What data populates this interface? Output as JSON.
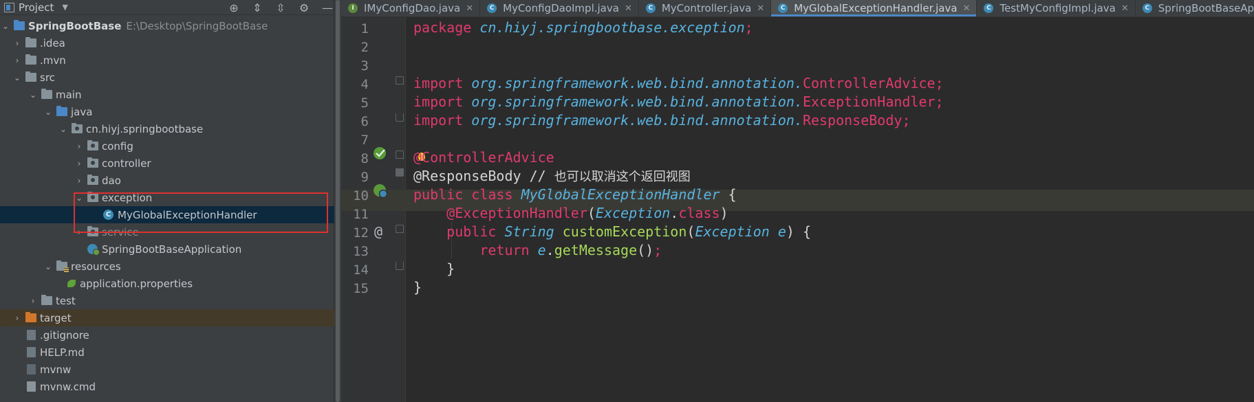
{
  "project_panel": {
    "title": "Project",
    "tree": [
      {
        "label": "SpringBootBase",
        "path": "E:\\Desktop\\SpringBootBase"
      },
      {
        "label": ".idea"
      },
      {
        "label": ".mvn"
      },
      {
        "label": "src"
      },
      {
        "label": "main"
      },
      {
        "label": "java"
      },
      {
        "label": "cn.hiyj.springbootbase"
      },
      {
        "label": "config"
      },
      {
        "label": "controller"
      },
      {
        "label": "dao"
      },
      {
        "label": "exception"
      },
      {
        "label": "MyGlobalExceptionHandler"
      },
      {
        "label": "service"
      },
      {
        "label": "SpringBootBaseApplication"
      },
      {
        "label": "resources"
      },
      {
        "label": "application.properties"
      },
      {
        "label": "test"
      },
      {
        "label": "target"
      },
      {
        "label": ".gitignore"
      },
      {
        "label": "HELP.md"
      },
      {
        "label": "mvnw"
      },
      {
        "label": "mvnw.cmd"
      }
    ]
  },
  "tabs": [
    {
      "label": "IMyConfigDao.java",
      "icon": "interface-icon"
    },
    {
      "label": "MyConfigDaoImpl.java",
      "icon": "class-icon"
    },
    {
      "label": "MyController.java",
      "icon": "class-icon"
    },
    {
      "label": "MyGlobalExceptionHandler.java",
      "icon": "class-icon",
      "active": true
    },
    {
      "label": "TestMyConfigImpl.java",
      "icon": "test-class-icon"
    },
    {
      "label": "SpringBootBaseApp",
      "icon": "spring-class-icon"
    }
  ],
  "editor": {
    "line_numbers": [
      "1",
      "2",
      "3",
      "4",
      "5",
      "6",
      "7",
      "8",
      "9",
      "10",
      "11",
      "12",
      "13",
      "14",
      "15"
    ],
    "lines": {
      "l1": {
        "kw": "package",
        "pkg": "cn.hiyj.springbootbase.exception",
        "semi": ";"
      },
      "l4": {
        "kw": "import",
        "pkg": "org.springframework.web.bind.annotation.",
        "cls": "ControllerAdvice",
        "semi": ";"
      },
      "l5": {
        "kw": "import",
        "pkg": "org.springframework.web.bind.annotation.",
        "cls": "ExceptionHandler",
        "semi": ";"
      },
      "l6": {
        "kw": "import",
        "pkg": "org.springframework.web.bind.annotation.",
        "cls": "ResponseBody",
        "semi": ";"
      },
      "l8": {
        "ann_first": "@",
        "ann_rest": "ControllerAdvice"
      },
      "l9": {
        "ann": "@ResponseBody",
        "comment": "//",
        "comment_text": "也可以取消这个返回视图"
      },
      "l10": {
        "kw1": "public",
        "kw2": "class",
        "type": "MyGlobalExceptionHandler",
        "brace": "{"
      },
      "l11": {
        "ann": "@ExceptionHandler",
        "open": "(",
        "type": "Exception",
        "dot": ".",
        "kw": "class",
        "close": ")"
      },
      "l12": {
        "kw": "public",
        "type1": "String",
        "method": "customException",
        "open": "(",
        "type2": "Exception",
        "param": "e",
        "close": ")",
        "brace": "{"
      },
      "l13": {
        "kw": "return",
        "var": "e",
        "dot": ".",
        "method": "getMessage",
        "parens": "()",
        "semi": ";"
      },
      "l14": {
        "brace": "}"
      },
      "l15": {
        "brace": "}"
      }
    }
  },
  "colors": {
    "keyword": "#e03a6e",
    "package": "#58b3e0",
    "method": "#a6d95a",
    "highlight_box": "#e03131",
    "selection": "#0d293e"
  }
}
